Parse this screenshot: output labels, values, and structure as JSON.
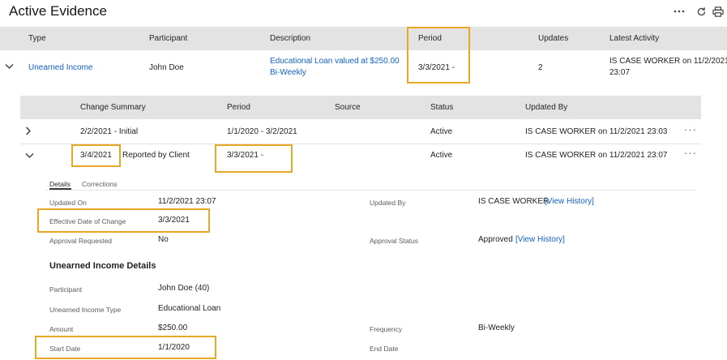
{
  "page_title": "Active Evidence",
  "toolbar": {
    "more_icon": "more-horizontal-icon",
    "refresh_icon": "refresh-icon",
    "print_icon": "printer-icon"
  },
  "table": {
    "headers": {
      "type": "Type",
      "participant": "Participant",
      "description": "Description",
      "period": "Period",
      "updates": "Updates",
      "latest_activity": "Latest Activity"
    },
    "row": {
      "type": "Unearned Income",
      "participant": "John Doe",
      "description_line1": "Educational Loan valued at $250.00",
      "description_line2": "Bi-Weekly",
      "period": "3/3/2021 -",
      "updates": "2",
      "latest_activity_line1": "IS CASE WORKER on 11/2/2021",
      "latest_activity_line2": "23:07"
    }
  },
  "subtable": {
    "headers": {
      "change_summary": "Change Summary",
      "period": "Period",
      "source": "Source",
      "status": "Status",
      "updated_by": "Updated By"
    },
    "rows": [
      {
        "change_summary": "2/2/2021 - Initial",
        "period": "1/1/2020 - 3/2/2021",
        "source": "",
        "status": "Active",
        "updated_by": "IS CASE WORKER on 11/2/2021 23:03"
      },
      {
        "change_date": "3/4/2021",
        "change_note": "Reported by Client",
        "period": "3/3/2021 -",
        "source": "",
        "status": "Active",
        "updated_by": "IS CASE WORKER on 11/2/2021 23:07"
      }
    ]
  },
  "tabs": {
    "details": "Details",
    "corrections": "Corrections"
  },
  "details": {
    "updated_on_label": "Updated On",
    "updated_on": "11/2/2021 23:07",
    "updated_by_label": "Updated By",
    "updated_by": "IS CASE WORKER",
    "updated_by_link": "[View History]",
    "effective_date_label": "Effective Date of Change",
    "effective_date": "3/3/2021",
    "approval_requested_label": "Approval Requested",
    "approval_requested": "No",
    "approval_status_label": "Approval Status",
    "approval_status": "Approved",
    "approval_status_link": "[View History]"
  },
  "section": {
    "title": "Unearned Income Details",
    "participant_label": "Participant",
    "participant": "John Doe (40)",
    "type_label": "Unearned Income Type",
    "type": "Educational Loan",
    "amount_label": "Amount",
    "amount": "$250.00",
    "frequency_label": "Frequency",
    "frequency": "Bi-Weekly",
    "start_date_label": "Start Date",
    "start_date": "1/1/2020",
    "end_date_label": "End Date"
  },
  "colors": {
    "highlight": "#e8a825",
    "link": "#1261c9",
    "header_bg": "#e3e3e3"
  }
}
